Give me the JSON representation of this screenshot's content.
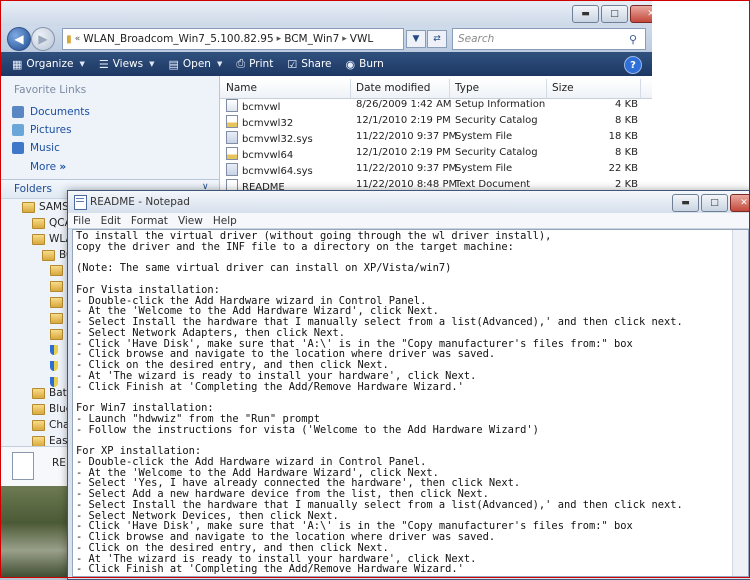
{
  "explorer": {
    "address": [
      "WLAN_Broadcom_Win7_5.100.82.95",
      "BCM_Win7",
      "VWL"
    ],
    "search_placeholder": "Search",
    "toolbar": {
      "organize": "Organize",
      "views": "Views",
      "open": "Open",
      "print": "Print",
      "share": "Share",
      "burn": "Burn"
    },
    "favorites": {
      "heading": "Favorite Links",
      "items": [
        "Documents",
        "Pictures",
        "Music"
      ],
      "more": "More"
    },
    "folders_heading": "Folders",
    "tree": [
      "SAMS",
      "QCA",
      "WLA",
      "BC",
      "Batt",
      "Blue",
      "Cha",
      "Easy"
    ],
    "details_name": "RE",
    "columns": {
      "name": "Name",
      "date": "Date modified",
      "type": "Type",
      "size": "Size"
    },
    "files": [
      {
        "name": "bcmvwl",
        "date": "8/26/2009 1:42 AM",
        "type": "Setup Information",
        "size": "4 KB"
      },
      {
        "name": "bcmvwl32",
        "date": "12/1/2010 2:19 PM",
        "type": "Security Catalog",
        "size": "8 KB"
      },
      {
        "name": "bcmvwl32.sys",
        "date": "11/22/2010 9:37 PM",
        "type": "System File",
        "size": "18 KB"
      },
      {
        "name": "bcmvwl64",
        "date": "12/1/2010 2:19 PM",
        "type": "Security Catalog",
        "size": "8 KB"
      },
      {
        "name": "bcmvwl64.sys",
        "date": "11/22/2010 9:37 PM",
        "type": "System File",
        "size": "22 KB"
      },
      {
        "name": "README",
        "date": "11/22/2010 8:48 PM",
        "type": "Text Document",
        "size": "2 KB"
      }
    ]
  },
  "notepad": {
    "title": "README - Notepad",
    "menu": [
      "File",
      "Edit",
      "Format",
      "View",
      "Help"
    ],
    "lines": [
      "To install the virtual driver (without going through the wl driver install),",
      "copy the driver and the INF file to a directory on the target machine:",
      "",
      "(Note: The same virtual driver can install on XP/Vista/win7)",
      "",
      "For Vista installation:",
      "- Double-click the Add Hardware wizard in Control Panel.",
      "- At the 'Welcome to the Add Hardware Wizard', click Next.",
      "- Select Install the hardware that I manually select from a list(Advanced),' and then click next.",
      "- Select Network Adapters, then click Next.",
      "- Click 'Have Disk', make sure that 'A:\\' is in the \"Copy manufacturer's files from:\" box",
      "- Click browse and navigate to the location where driver was saved.",
      "- Click on the desired entry, and then click Next.",
      "- At 'The wizard is ready to install your hardware', click Next.",
      "- Click Finish at 'Completing the Add/Remove Hardware Wizard.'",
      "",
      "For Win7 installation:",
      "- Launch \"hdwwiz\" from the \"Run\" prompt",
      "- Follow the instructions for vista ('Welcome to the Add Hardware Wizard')",
      "",
      "For XP installation:",
      "- Double-click the Add Hardware wizard in Control Panel.",
      "- At the 'Welcome to the Add Hardware Wizard', click Next.",
      "- Select 'Yes, I have already connected the hardware', then click Next.",
      "- Select Add a new hardware device from the list, then click Next.",
      "- Select Install the hardware that I manually select from a list(Advanced),' and then click next.",
      "- Select Network Devices, then click Next.",
      "- Click 'Have Disk', make sure that 'A:\\' is in the \"Copy manufacturer's files from:\" box",
      "- Click browse and navigate to the location where driver was saved.",
      "- Click on the desired entry, and then click Next.",
      "- At 'The wizard is ready to install your hardware', click Next.",
      "- Click Finish at 'Completing the Add/Remove Hardware Wizard.'"
    ]
  }
}
